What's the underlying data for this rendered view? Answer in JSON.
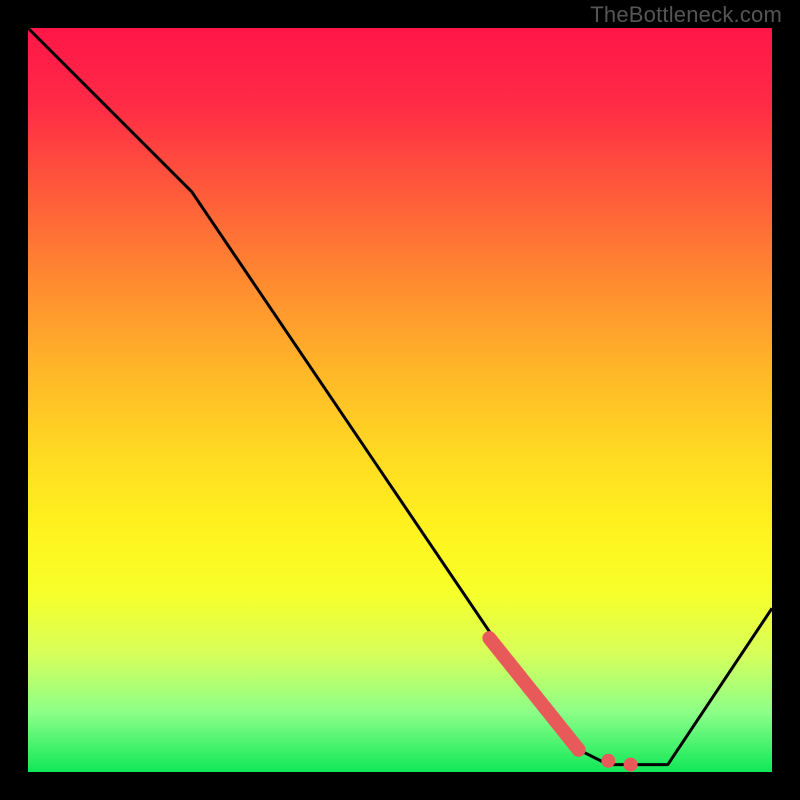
{
  "watermark": "TheBottleneck.com",
  "chart_data": {
    "type": "line",
    "title": "",
    "xlabel": "",
    "ylabel": "",
    "xlim": [
      0,
      100
    ],
    "ylim": [
      0,
      100
    ],
    "series": [
      {
        "name": "bottleneck-curve",
        "x": [
          0,
          22,
          66,
          68,
          74,
          78,
          82,
          86,
          100
        ],
        "values": [
          100,
          78,
          13,
          10,
          3,
          1,
          1,
          1,
          22
        ]
      }
    ],
    "highlight_segment": {
      "name": "optimal-range",
      "x": [
        62,
        74
      ],
      "values": [
        18,
        3
      ]
    },
    "highlight_dots": [
      {
        "x": 74,
        "y": 3
      },
      {
        "x": 78,
        "y": 1.5
      },
      {
        "x": 81,
        "y": 1
      }
    ],
    "colors": {
      "curve": "#000000",
      "highlight": "#e85a5a",
      "gradient_top": "#ff1648",
      "gradient_bottom": "#10e858"
    }
  }
}
